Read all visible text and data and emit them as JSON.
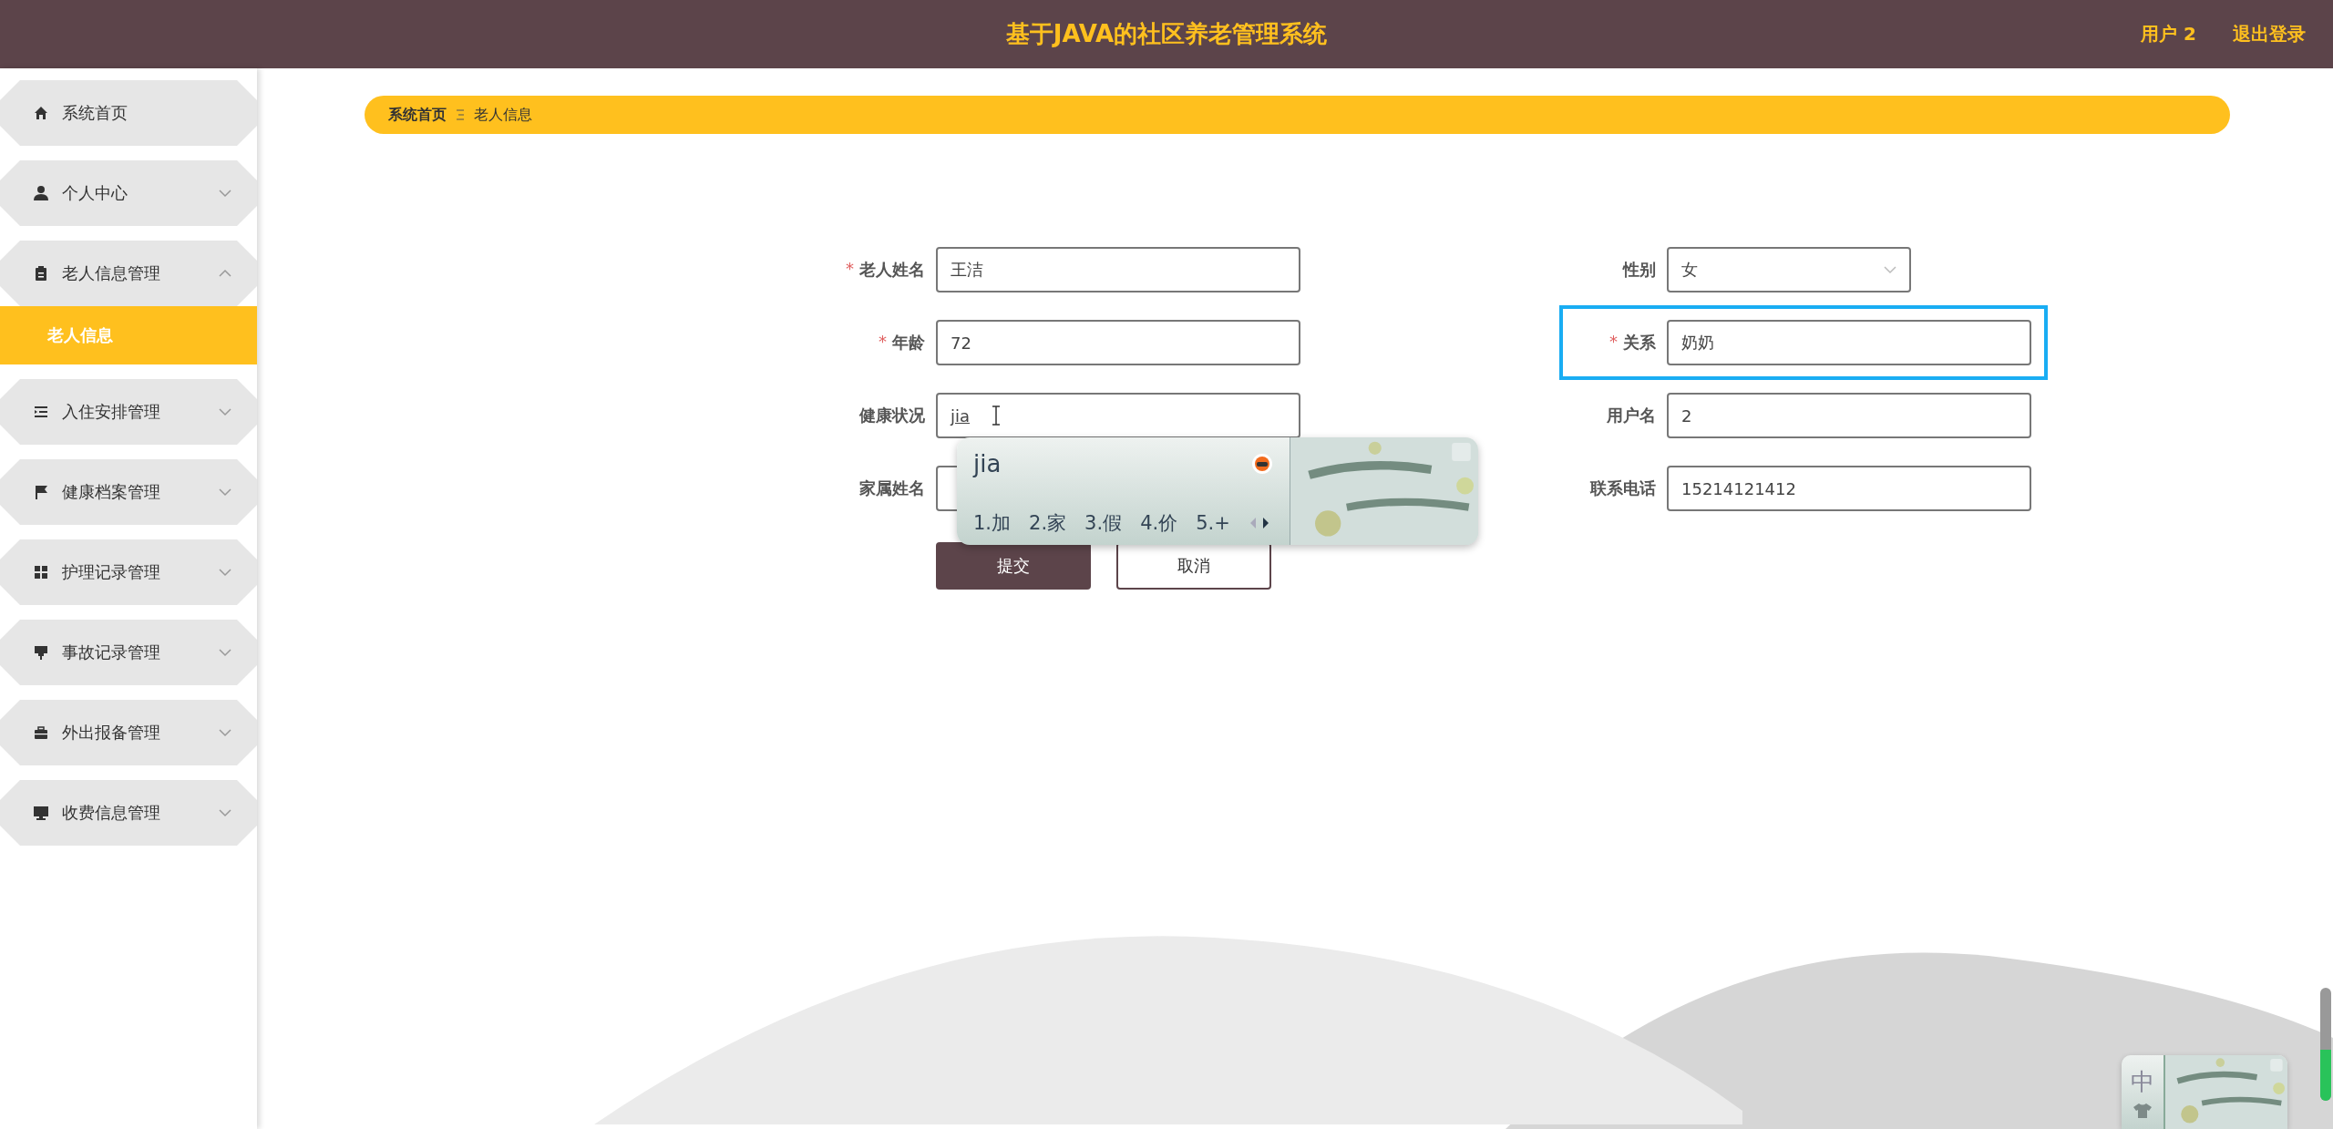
{
  "header": {
    "title": "基于JAVA的社区养老管理系统",
    "user": "用户 2",
    "logout": "退出登录"
  },
  "sidebar": {
    "items": [
      {
        "label": "系统首页",
        "kind": "link"
      },
      {
        "label": "个人中心",
        "kind": "menu",
        "expanded": false
      },
      {
        "label": "老人信息管理",
        "kind": "menu",
        "expanded": true,
        "children": [
          {
            "label": "老人信息",
            "selected": true
          }
        ]
      },
      {
        "label": "入住安排管理",
        "kind": "menu",
        "expanded": false
      },
      {
        "label": "健康档案管理",
        "kind": "menu",
        "expanded": false
      },
      {
        "label": "护理记录管理",
        "kind": "menu",
        "expanded": false
      },
      {
        "label": "事故记录管理",
        "kind": "menu",
        "expanded": false
      },
      {
        "label": "外出报备管理",
        "kind": "menu",
        "expanded": false
      },
      {
        "label": "收费信息管理",
        "kind": "menu",
        "expanded": false
      }
    ]
  },
  "breadcrumb": [
    "系统首页",
    "老人信息"
  ],
  "form": {
    "left": [
      {
        "label": "老人姓名",
        "mark": "*",
        "kind": "text",
        "value": "王洁"
      },
      {
        "label": "年龄",
        "mark": "*",
        "kind": "text",
        "value": "72"
      },
      {
        "label": "健康状况",
        "kind": "text",
        "value": "jia",
        "composing": true
      },
      {
        "label": "家属姓名",
        "kind": "text"
      }
    ],
    "right": [
      {
        "label": "性别",
        "kind": "select",
        "value": "女",
        "highlighted": false
      },
      {
        "label": "关系",
        "mark": "*",
        "kind": "text",
        "value": "奶奶",
        "highlighted": true
      },
      {
        "label": "用户名",
        "kind": "text",
        "value": "2",
        "highlighted": false
      },
      {
        "label": "联系电话",
        "kind": "text",
        "value": "15214121412",
        "highlighted": false
      }
    ],
    "buttons": [
      {
        "label": "提交",
        "kind": "primary"
      },
      {
        "label": "取消",
        "kind": "secondary"
      }
    ]
  },
  "ime": {
    "composition": "jia",
    "candidates": [
      "1.加",
      "2.家",
      "3.假",
      "4.价",
      "5.+"
    ],
    "status": "中"
  },
  "volume_meter": {
    "level": 0.45
  }
}
